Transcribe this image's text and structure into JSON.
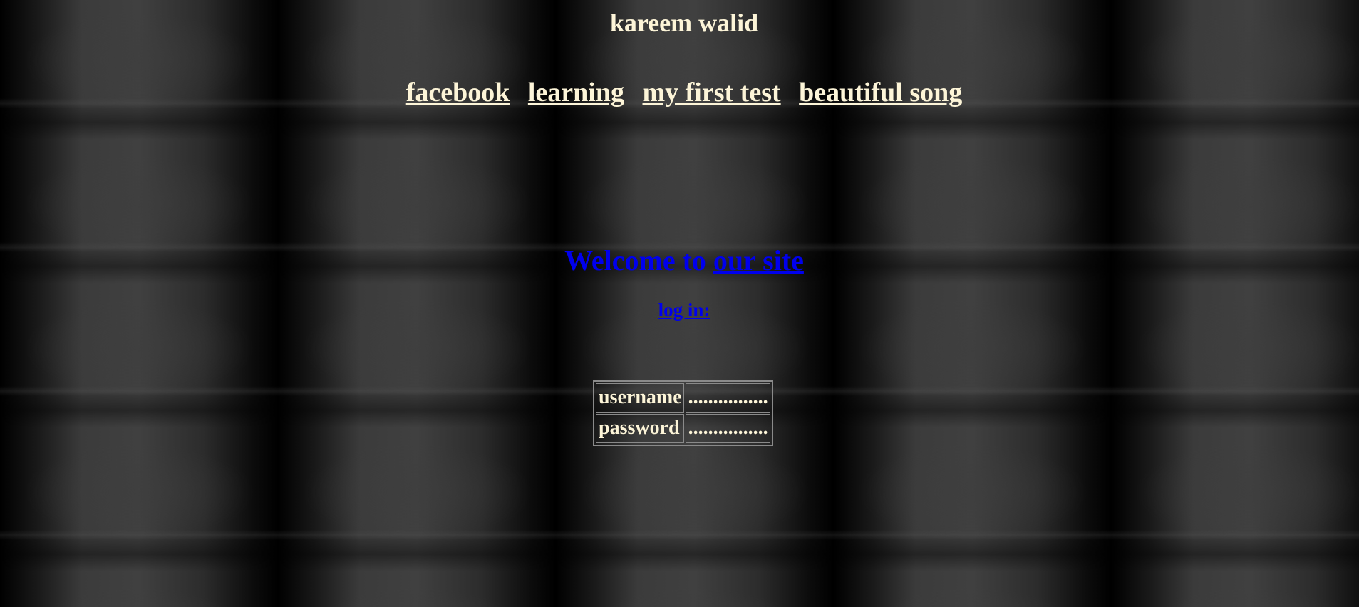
{
  "site": {
    "title": "kareem walid"
  },
  "nav": {
    "links": [
      {
        "label": "facebook"
      },
      {
        "label": "learning"
      },
      {
        "label": "my first test"
      },
      {
        "label": "beautiful song"
      }
    ]
  },
  "main": {
    "welcome_prefix": "Welcome to ",
    "welcome_link": "our site",
    "login_link": "log in:"
  },
  "login_form": {
    "rows": [
      {
        "label": "username",
        "value": "................"
      },
      {
        "label": "password",
        "value": "................"
      }
    ]
  },
  "colors": {
    "text": "#fdf5d8",
    "link_blue": "#0000ee",
    "background": "#141414"
  }
}
